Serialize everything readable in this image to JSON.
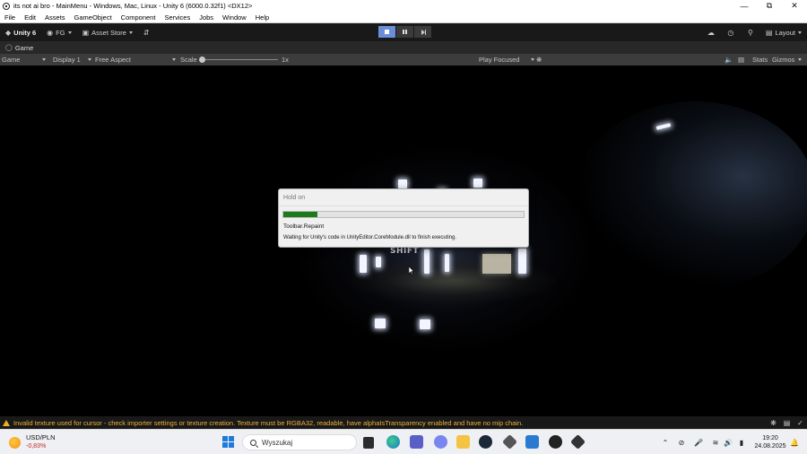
{
  "window": {
    "title": "its not ai bro - MainMenu - Windows, Mac, Linux - Unity 6 (6000.0.32f1) <DX12>",
    "minimize": "—",
    "restore": "⧉",
    "close": "✕"
  },
  "menu": [
    "File",
    "Edit",
    "Assets",
    "GameObject",
    "Component",
    "Services",
    "Jobs",
    "Window",
    "Help"
  ],
  "toolbar": {
    "unity_label": "Unity 6",
    "account_label": "FG",
    "asset_store_label": "Asset Store",
    "layout_label": "Layout",
    "play_state": "playing"
  },
  "game_tab": {
    "label": "Game"
  },
  "game_bar": {
    "mode": "Game",
    "display": "Display 1",
    "aspect": "Free Aspect",
    "scale_label": "Scale",
    "scale_value": "1x",
    "play_focused": "Play Focused",
    "stats": "Stats",
    "gizmos": "Gizmos"
  },
  "scene": {
    "sign_text": "SHIFT"
  },
  "dialog": {
    "title": "Hold on",
    "progress": 0.14,
    "task": "Toolbar.Repaint",
    "message": "Waiting for Unity's code in UnityEditor.CoreModule.dll to finish executing."
  },
  "console": {
    "warning": "Invalid texture used for cursor - check importer settings or texture creation. Texture must be RGBA32, readable, have alphaIsTransparency enabled and have no mip chain."
  },
  "taskbar": {
    "ticker_name": "USD/PLN",
    "ticker_change": "-0,83%",
    "search_placeholder": "Wyszukaj",
    "time": "19:20",
    "date": "24.08.2025"
  },
  "colors": {
    "progress_fill": "#1c7a1c",
    "warning": "#f0b23a",
    "play_active": "#6a8fd8"
  }
}
